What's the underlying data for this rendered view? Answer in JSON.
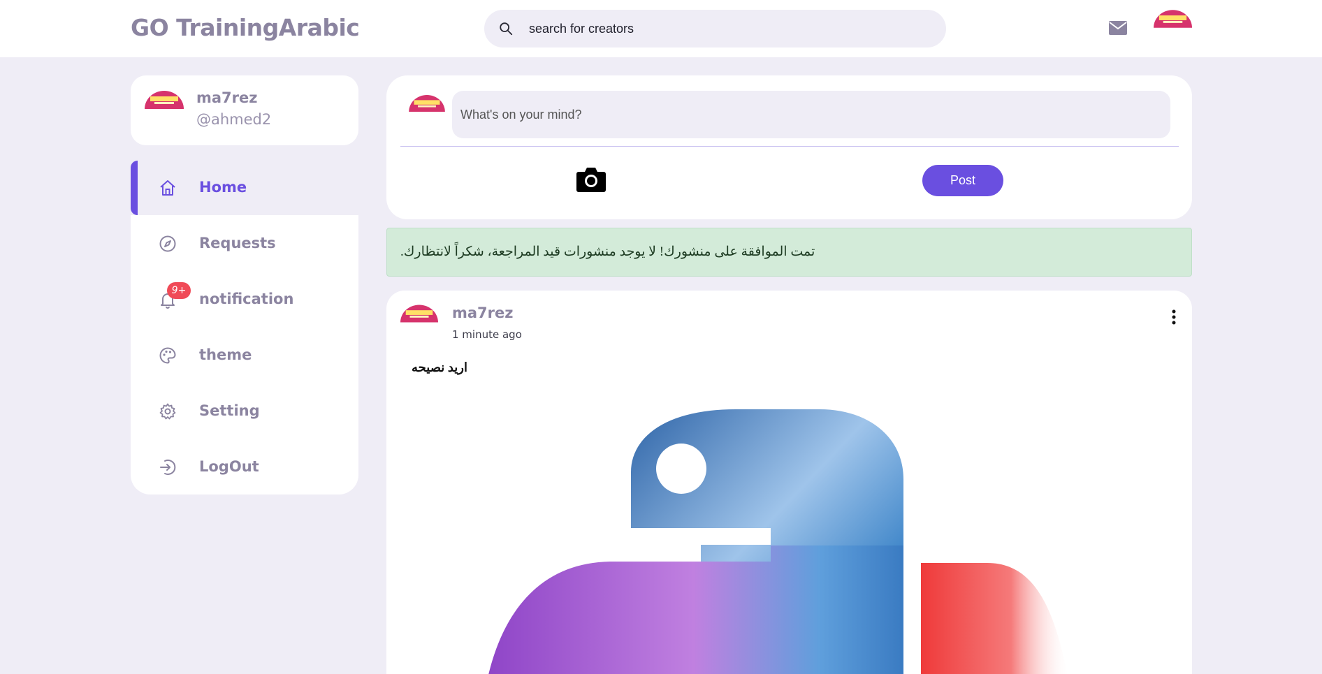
{
  "app": {
    "title": "GO TrainingArabic"
  },
  "header": {
    "search_placeholder": "search for creators",
    "mail_icon": "envelope-icon",
    "avatar_icon": "user-avatar"
  },
  "profile": {
    "name": "ma7rez",
    "handle": "@ahmed2"
  },
  "sidebar": {
    "items": [
      {
        "label": "Home",
        "icon": "home-icon",
        "active": true
      },
      {
        "label": "Requests",
        "icon": "compass-icon",
        "active": false
      },
      {
        "label": "notification",
        "icon": "bell-icon",
        "active": false,
        "badge": "9+"
      },
      {
        "label": "theme",
        "icon": "palette-icon",
        "active": false
      },
      {
        "label": "Setting",
        "icon": "gear-icon",
        "active": false
      },
      {
        "label": "LogOut",
        "icon": "logout-icon",
        "active": false
      }
    ]
  },
  "composer": {
    "placeholder": "What's on your mind?",
    "post_label": "Post",
    "camera_icon": "camera-icon"
  },
  "alert": {
    "text": "تمت الموافقة على منشورك! لا يوجد منشورات قيد المراجعة، شكراً لانتظارك."
  },
  "post": {
    "author": "ma7rez",
    "time": "1 minute ago",
    "text": "اريد نصيحه",
    "image": "python-logo-image"
  },
  "colors": {
    "accent": "#6a4fe0",
    "background": "#efedf6",
    "badge": "#f04a57",
    "alert_bg": "#d3ebd9"
  }
}
